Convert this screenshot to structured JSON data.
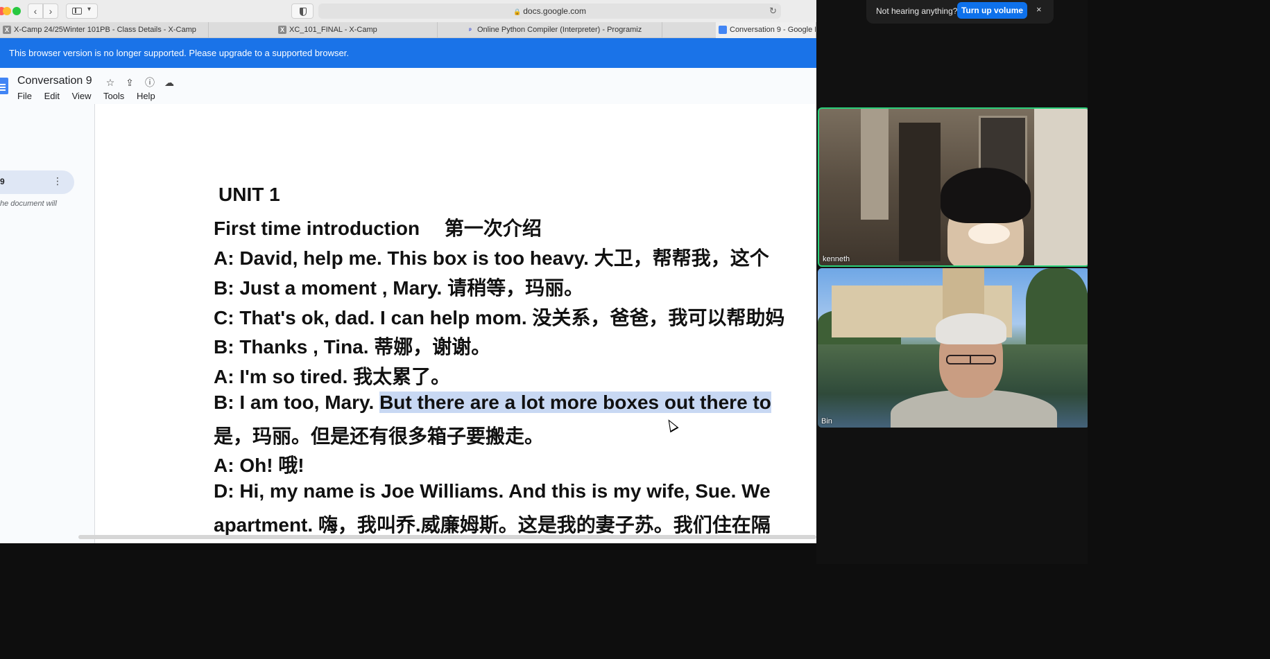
{
  "browser": {
    "url": "docs.google.com",
    "tabs": [
      {
        "label": "X-Camp 24/25Winter 101PB - Class Details - X-Camp",
        "icon": "x-camp-favicon"
      },
      {
        "label": "XC_101_FINAL - X-Camp",
        "icon": "x-camp-favicon"
      },
      {
        "label": "Online Python Compiler (Interpreter) - Programiz",
        "icon": "programiz-favicon"
      },
      {
        "label": "Conversation 9 - Google D",
        "icon": "google-docs-favicon"
      }
    ],
    "banner": "This browser version is no longer supported. Please upgrade to a supported browser."
  },
  "doc": {
    "title": "Conversation 9",
    "menu": [
      "File",
      "Edit",
      "View",
      "Tools",
      "Help"
    ],
    "outline": {
      "item": "9",
      "hint": "he document will"
    },
    "lines": [
      {
        "text": "UNIT 1"
      },
      {
        "text": "First time introduction　 第一次介绍"
      },
      {
        "text": "A: David, help me. This box is too heavy. 大卫，帮帮我，这个"
      },
      {
        "text": "B: Just a moment , Mary. 请稍等，玛丽。"
      },
      {
        "text": "C: That's ok, dad. I can help mom. 没关系，爸爸，我可以帮助妈"
      },
      {
        "text": "B: Thanks , Tina. 蒂娜，谢谢。"
      },
      {
        "text": "A: I'm so tired. 我太累了。"
      },
      {
        "pre": "B: I am too, Mary. ",
        "highlight": "But there are a lot more boxes out there to"
      },
      {
        "text": "是，玛丽。但是还有很多箱子要搬走。"
      },
      {
        "text": "A: Oh! 哦!"
      },
      {
        "text": "D: Hi, my name is Joe Williams. And this is my wife, Sue. We"
      },
      {
        "text": "apartment. 嗨，我叫乔.威廉姆斯。这是我的妻子苏。我们住在隔"
      }
    ]
  },
  "call": {
    "toast_text": "Not hearing anything?",
    "toast_button": "Turn up volume",
    "toast_close": "×",
    "participants": [
      {
        "name": "kenneth",
        "active_speaker": true
      },
      {
        "name": "Bin",
        "active_speaker": false
      }
    ]
  },
  "colors": {
    "banner": "#1a73e8",
    "highlight": "#c8d8f3",
    "active_speaker_border": "#2ad07a",
    "volume_button": "#0e71eb"
  }
}
